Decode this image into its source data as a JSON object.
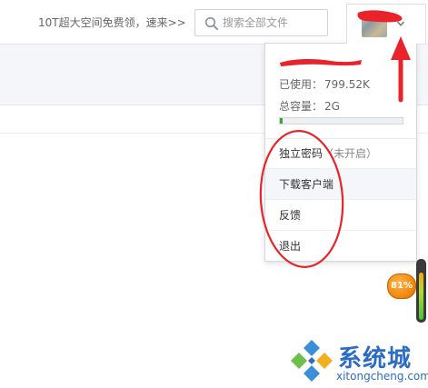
{
  "header": {
    "promo_text": "10T超大空间免费领，速来>>",
    "search": {
      "placeholder": "搜索全部文件",
      "value": ""
    }
  },
  "user_menu": {
    "quota": {
      "used_label": "已使用：",
      "used_value": "799.52K",
      "total_label": "总容量：",
      "total_value": "2G",
      "used_fraction": 0.004
    },
    "items": [
      {
        "label": "独立密码",
        "note": "（未开启）"
      },
      {
        "label": "下载客户端"
      },
      {
        "label": "反馈"
      },
      {
        "label": "退出"
      }
    ]
  },
  "widget": {
    "speed_badge": "81%",
    "meter_fraction": 0.81
  },
  "watermark": {
    "brand": "系统城",
    "domain": "xitongcheng.com"
  },
  "colors": {
    "quota_fill": "#3aa531",
    "annotation_red": "#e8232a",
    "badge_orange": "#f28b12",
    "watermark_blue": "#2b6cc4"
  },
  "icons": {
    "search": "search-icon",
    "dropdown": "chevron-down-icon"
  }
}
